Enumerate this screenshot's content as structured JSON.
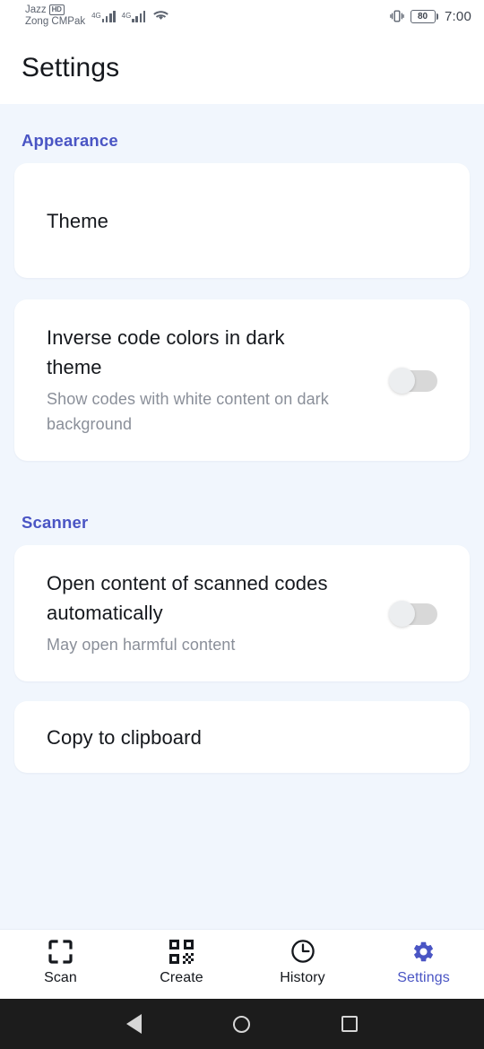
{
  "status_bar": {
    "carrier_primary": "Jazz",
    "carrier_primary_badge": "HD",
    "carrier_secondary": "Zong CMPak",
    "network_type_1": "4G",
    "network_type_2": "4G",
    "wifi_icon": "wifi-icon",
    "vibrate_icon": "vibrate-icon",
    "battery_level": "80",
    "time": "7:00"
  },
  "header": {
    "title": "Settings"
  },
  "sections": [
    {
      "title": "Appearance",
      "items": [
        {
          "title": "Theme",
          "subtitle": "",
          "control": "none"
        },
        {
          "title": "Inverse code colors in dark theme",
          "subtitle": "Show codes with white content on dark background",
          "control": "toggle",
          "toggle_state": "off"
        }
      ]
    },
    {
      "title": "Scanner",
      "items": [
        {
          "title": "Open content of scanned codes automatically",
          "subtitle": "May open harmful content",
          "control": "toggle",
          "toggle_state": "off"
        },
        {
          "title": "Copy to clipboard",
          "subtitle": "",
          "control": "toggle",
          "toggle_state": "off"
        }
      ]
    }
  ],
  "bottom_nav": {
    "items": [
      {
        "label": "Scan",
        "icon": "scan-frame-icon",
        "active": false
      },
      {
        "label": "Create",
        "icon": "qr-code-icon",
        "active": false
      },
      {
        "label": "History",
        "icon": "clock-icon",
        "active": false
      },
      {
        "label": "Settings",
        "icon": "gear-icon",
        "active": true
      }
    ]
  },
  "android_nav": {
    "back": "back-triangle-icon",
    "home": "home-circle-icon",
    "recents": "recents-square-icon"
  },
  "colors": {
    "accent": "#4a55c4",
    "background": "#f1f6fd",
    "card": "#ffffff",
    "text_primary": "#15181d",
    "text_secondary": "#8a8f99",
    "android_nav_bg": "#1c1c1c"
  }
}
